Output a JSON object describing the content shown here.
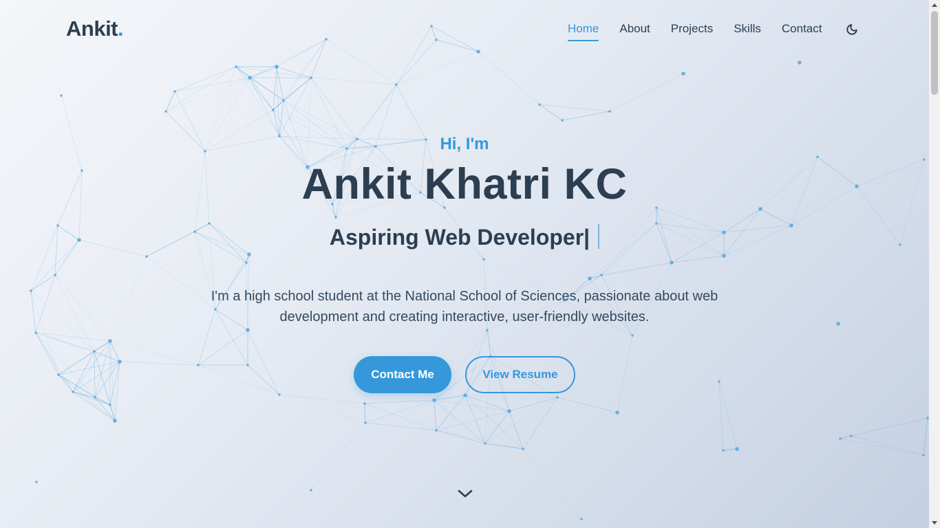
{
  "nav": {
    "logo_text": "Ankit",
    "logo_dot": ".",
    "links": [
      {
        "label": "Home",
        "active": true
      },
      {
        "label": "About",
        "active": false
      },
      {
        "label": "Projects",
        "active": false
      },
      {
        "label": "Skills",
        "active": false
      },
      {
        "label": "Contact",
        "active": false
      }
    ],
    "theme_toggle_icon": "moon-icon"
  },
  "hero": {
    "greeting": "Hi, I'm",
    "name": "Ankit Khatri KC",
    "role": "Aspiring Web Developer|",
    "bio": "I'm a high school student at the National School of Sciences, passionate about web development and creating interactive, user-friendly websites.",
    "primary_button": "Contact Me",
    "secondary_button": "View Resume",
    "scroll_icon": "chevron-down-icon"
  },
  "colors": {
    "accent": "#3498db",
    "text": "#2c3e50",
    "background_start": "#f4f6f9",
    "background_end": "#c3cfe2"
  }
}
